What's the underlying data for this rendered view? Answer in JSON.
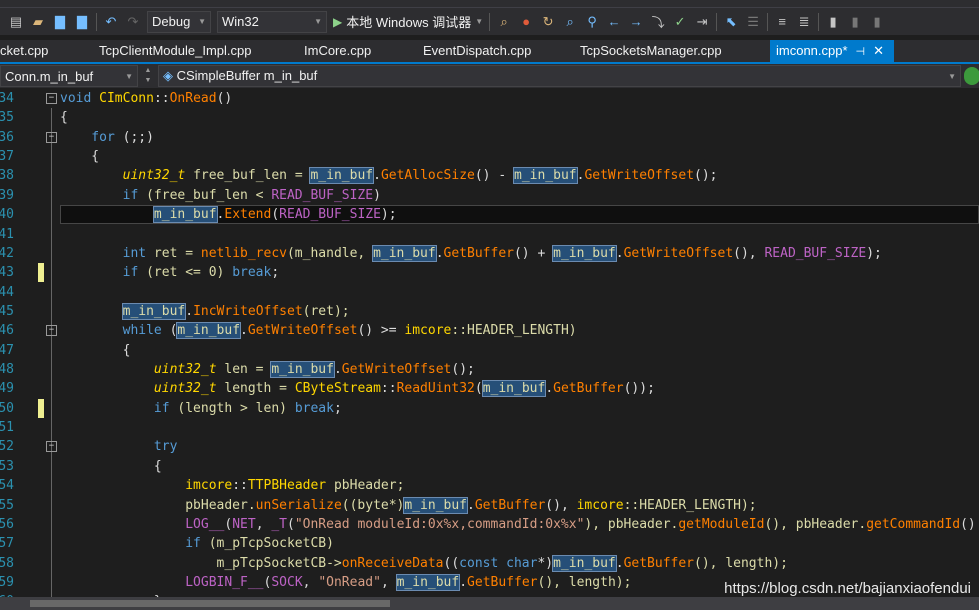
{
  "toolbar": {
    "config": "Debug",
    "platform": "Win32",
    "run_label": "本地 Windows 调试器"
  },
  "tabs": [
    {
      "label": "cket.cpp"
    },
    {
      "label": "TcpClientModule_Impl.cpp"
    },
    {
      "label": "ImCore.cpp"
    },
    {
      "label": "EventDispatch.cpp"
    },
    {
      "label": "TcpSocketsManager.cpp"
    },
    {
      "label": "imconn.cpp*",
      "active": true
    }
  ],
  "nav": {
    "scope": "Conn.m_in_buf",
    "member": "CSimpleBuffer m_in_buf"
  },
  "editor": {
    "current_line": "40",
    "lines": [
      {
        "n": "34",
        "fold": true,
        "tok": [
          [
            "void ",
            "k"
          ],
          [
            "CImConn",
            "c"
          ],
          [
            "::",
            "o"
          ],
          [
            "OnRead",
            "f"
          ],
          [
            "()",
            "o"
          ]
        ]
      },
      {
        "n": "35",
        "tok": [
          [
            "{",
            "o"
          ]
        ]
      },
      {
        "n": "36",
        "fold": true,
        "tok": [
          [
            "    for ",
            "k"
          ],
          [
            "(;;)",
            "o"
          ]
        ]
      },
      {
        "n": "37",
        "tok": [
          [
            "    {",
            "o"
          ]
        ]
      },
      {
        "n": "38",
        "tok": [
          [
            "        ",
            "o"
          ],
          [
            "uint32_t",
            "t"
          ],
          [
            " free_buf_len = ",
            "p"
          ],
          [
            "m_in_buf",
            "v"
          ],
          [
            ".",
            "o"
          ],
          [
            "GetAllocSize",
            "f"
          ],
          [
            "() - ",
            "o"
          ],
          [
            "m_in_buf",
            "v"
          ],
          [
            ".",
            "o"
          ],
          [
            "GetWriteOffset",
            "f"
          ],
          [
            "();",
            "o"
          ]
        ]
      },
      {
        "n": "39",
        "tok": [
          [
            "        if ",
            "k"
          ],
          [
            "(free_buf_len < ",
            "p"
          ],
          [
            "READ_BUF_SIZE",
            "m"
          ],
          [
            ")",
            "o"
          ]
        ]
      },
      {
        "n": "40",
        "tok": [
          [
            "            ",
            "o"
          ],
          [
            "m_in_buf",
            "v"
          ],
          [
            ".",
            "o"
          ],
          [
            "Extend",
            "f"
          ],
          [
            "(",
            "o"
          ],
          [
            "READ_BUF_SIZE",
            "m"
          ],
          [
            ");",
            "o"
          ]
        ]
      },
      {
        "n": "41",
        "tok": []
      },
      {
        "n": "42",
        "tok": [
          [
            "        int ",
            "k"
          ],
          [
            "ret = ",
            "p"
          ],
          [
            "netlib_recv",
            "f"
          ],
          [
            "(m_handle, ",
            "p"
          ],
          [
            "m_in_buf",
            "v"
          ],
          [
            ".",
            "o"
          ],
          [
            "GetBuffer",
            "f"
          ],
          [
            "() + ",
            "o"
          ],
          [
            "m_in_buf",
            "v"
          ],
          [
            ".",
            "o"
          ],
          [
            "GetWriteOffset",
            "f"
          ],
          [
            "(), ",
            "o"
          ],
          [
            "READ_BUF_SIZE",
            "m"
          ],
          [
            ");",
            "o"
          ]
        ]
      },
      {
        "n": "43",
        "mark": true,
        "tok": [
          [
            "        if ",
            "k"
          ],
          [
            "(ret <= 0) ",
            "p"
          ],
          [
            "break",
            "k"
          ],
          [
            ";",
            "o"
          ]
        ]
      },
      {
        "n": "44",
        "tok": []
      },
      {
        "n": "45",
        "tok": [
          [
            "        ",
            "o"
          ],
          [
            "m_in_buf",
            "v"
          ],
          [
            ".",
            "o"
          ],
          [
            "IncWriteOffset",
            "f"
          ],
          [
            "(ret);",
            "p"
          ]
        ]
      },
      {
        "n": "46",
        "fold": true,
        "tok": [
          [
            "        while ",
            "k"
          ],
          [
            "(",
            "o"
          ],
          [
            "m_in_buf",
            "v"
          ],
          [
            ".",
            "o"
          ],
          [
            "GetWriteOffset",
            "f"
          ],
          [
            "() >= ",
            "o"
          ],
          [
            "imcore",
            "c"
          ],
          [
            "::HEADER_LENGTH)",
            "p"
          ]
        ]
      },
      {
        "n": "47",
        "tok": [
          [
            "        {",
            "o"
          ]
        ]
      },
      {
        "n": "48",
        "tok": [
          [
            "            ",
            "o"
          ],
          [
            "uint32_t",
            "t"
          ],
          [
            " len = ",
            "p"
          ],
          [
            "m_in_buf",
            "v"
          ],
          [
            ".",
            "o"
          ],
          [
            "GetWriteOffset",
            "f"
          ],
          [
            "();",
            "o"
          ]
        ]
      },
      {
        "n": "49",
        "tok": [
          [
            "            ",
            "o"
          ],
          [
            "uint32_t",
            "t"
          ],
          [
            " length = ",
            "p"
          ],
          [
            "CByteStream",
            "c"
          ],
          [
            "::",
            "o"
          ],
          [
            "ReadUint32",
            "f"
          ],
          [
            "(",
            "o"
          ],
          [
            "m_in_buf",
            "v"
          ],
          [
            ".",
            "o"
          ],
          [
            "GetBuffer",
            "f"
          ],
          [
            "());",
            "o"
          ]
        ]
      },
      {
        "n": "50",
        "mark": true,
        "tok": [
          [
            "            if ",
            "k"
          ],
          [
            "(length > len) ",
            "p"
          ],
          [
            "break",
            "k"
          ],
          [
            ";",
            "o"
          ]
        ]
      },
      {
        "n": "51",
        "tok": []
      },
      {
        "n": "52",
        "fold": true,
        "tok": [
          [
            "            try",
            "k"
          ]
        ]
      },
      {
        "n": "53",
        "tok": [
          [
            "            {",
            "o"
          ]
        ]
      },
      {
        "n": "54",
        "tok": [
          [
            "                ",
            "o"
          ],
          [
            "imcore",
            "c"
          ],
          [
            "::",
            "o"
          ],
          [
            "TTPBHeader",
            "c"
          ],
          [
            " pbHeader;",
            "p"
          ]
        ]
      },
      {
        "n": "55",
        "tok": [
          [
            "                pbHeader.",
            "p"
          ],
          [
            "unSerialize",
            "f"
          ],
          [
            "((byte*)",
            "p"
          ],
          [
            "m_in_buf",
            "v"
          ],
          [
            ".",
            "o"
          ],
          [
            "GetBuffer",
            "f"
          ],
          [
            "(), ",
            "o"
          ],
          [
            "imcore",
            "c"
          ],
          [
            "::HEADER_LENGTH);",
            "p"
          ]
        ]
      },
      {
        "n": "56",
        "tok": [
          [
            "                ",
            "o"
          ],
          [
            "LOG__",
            "m"
          ],
          [
            "(",
            "o"
          ],
          [
            "NET",
            "m"
          ],
          [
            ", ",
            "o"
          ],
          [
            "_T",
            "m"
          ],
          [
            "(",
            "o"
          ],
          [
            "\"OnRead moduleId:0x%x,commandId:0x%x\"",
            "s"
          ],
          [
            "), pbHeader.",
            "p"
          ],
          [
            "getModuleId",
            "f"
          ],
          [
            "(), pbHeader.",
            "p"
          ],
          [
            "getCommandId",
            "f"
          ],
          [
            "()",
            "o"
          ]
        ]
      },
      {
        "n": "57",
        "tok": [
          [
            "                if ",
            "k"
          ],
          [
            "(m_pTcpSocketCB)",
            "p"
          ]
        ]
      },
      {
        "n": "58",
        "tok": [
          [
            "                    m_pTcpSocketCB->",
            "p"
          ],
          [
            "onReceiveData",
            "f"
          ],
          [
            "((",
            "o"
          ],
          [
            "const char",
            "k"
          ],
          [
            "*)",
            "o"
          ],
          [
            "m_in_buf",
            "v"
          ],
          [
            ".",
            "o"
          ],
          [
            "GetBuffer",
            "f"
          ],
          [
            "(), length);",
            "p"
          ]
        ]
      },
      {
        "n": "59",
        "tok": [
          [
            "                ",
            "o"
          ],
          [
            "LOGBIN_F__",
            "m"
          ],
          [
            "(",
            "o"
          ],
          [
            "SOCK",
            "m"
          ],
          [
            ", ",
            "o"
          ],
          [
            "\"OnRead\"",
            "s"
          ],
          [
            ", ",
            "o"
          ],
          [
            "m_in_buf",
            "v"
          ],
          [
            ".",
            "o"
          ],
          [
            "GetBuffer",
            "f"
          ],
          [
            "(), length);",
            "p"
          ]
        ]
      },
      {
        "n": "60",
        "tok": [
          [
            "            }",
            "o"
          ]
        ]
      }
    ]
  },
  "watermark": "https://blog.csdn.net/bajianxiaofendui"
}
